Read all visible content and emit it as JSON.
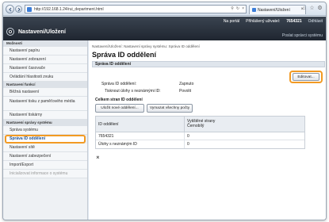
{
  "browser": {
    "url": "http://192.168.1.24/rui_department.html",
    "tab_title": "Nastavení/Uložení"
  },
  "header": {
    "portal_label": "Na portál",
    "user_label": "Přihlášený uživatel:",
    "user_value": "7654321",
    "logout_label": "Odhlásit",
    "app_title": "Nastavení/Uložení",
    "mail_link": "Poslat správci systému"
  },
  "sidebar": {
    "sections": [
      {
        "title": "Možnosti",
        "items": [
          "Nastavení papíru",
          "Nastavení zobrazení",
          "Nastavení časovače",
          "Ovládání hlasitosti zvuku"
        ]
      },
      {
        "title": "Nastavení funkcí",
        "items": [
          "Běžná nastavení",
          "Nastavení tisku z paměťového média",
          "Nastavení tiskárny"
        ]
      },
      {
        "title": "Nastavení správy systému",
        "items": [
          "Správa systému",
          "Správa ID oddělení",
          "Nastavení sítě",
          "Nastavení zabezpečení",
          "Import/Export",
          "Inicializovat informace o systému"
        ]
      }
    ]
  },
  "main": {
    "breadcrumb": "Nastavení/Uložení: Nastavení správy systému: Správa ID oddělení",
    "title": "Správa ID oddělení",
    "section_title": "Správa ID oddělení",
    "edit_button": "Editovat...",
    "kv": [
      {
        "label": "Správa ID oddělení:",
        "value": "Zapnuto"
      },
      {
        "label": "Tisknout úlohy s neznámými ID:",
        "value": "Povolit"
      }
    ],
    "subsection_title": "Celkem stran ID oddělení",
    "register_button": "Uložit nové oddělení...",
    "clear_button": "Vymazat všechny počty",
    "table": {
      "col1": "ID oddělení",
      "col2_line1": "Vytištěné strany",
      "col2_line2": "Černobílý",
      "rows": [
        {
          "id": "7654321",
          "count": "0"
        },
        {
          "id": "Úlohy s neznámým ID",
          "count": "0"
        }
      ]
    },
    "top_link": "⌅"
  }
}
